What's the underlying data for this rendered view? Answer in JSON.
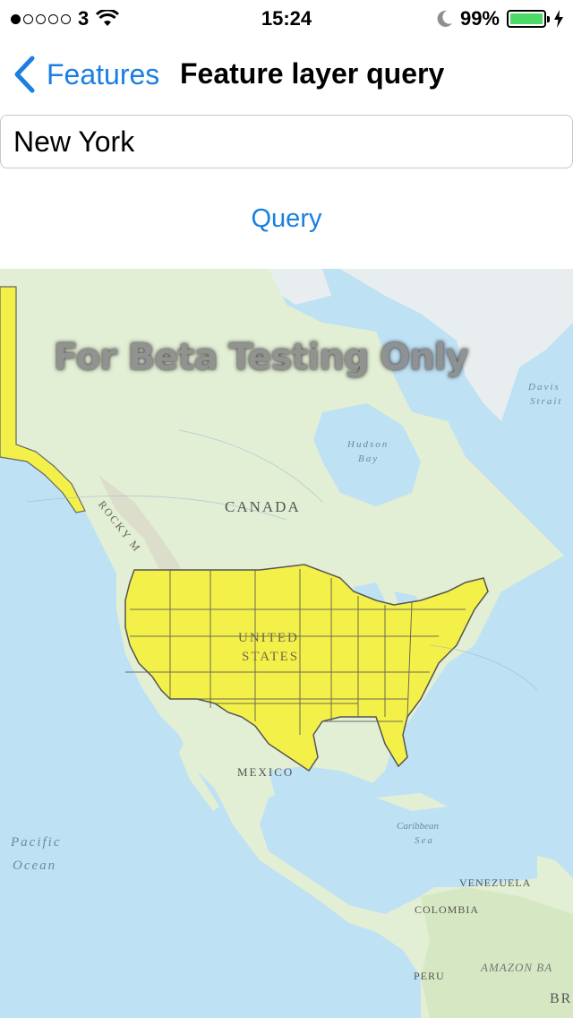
{
  "status_bar": {
    "carrier": "3",
    "time": "15:24",
    "battery": "99%",
    "battery_level": 0.99,
    "signal_bars_filled": 1,
    "signal_bars_total": 5
  },
  "nav": {
    "back_label": "Features",
    "title": "Feature layer query"
  },
  "search": {
    "value": "New York"
  },
  "query_button": {
    "label": "Query"
  },
  "map": {
    "watermark": "For Beta Testing Only",
    "labels": {
      "canada": "CANADA",
      "united": "UNITED",
      "states": "STATES",
      "mexico": "MEXICO",
      "hudson": "Hudson",
      "bay": "Bay",
      "davis": "Davis",
      "strait": "Strait",
      "rocky": "ROCKY M",
      "pacific": "Pacific",
      "ocean": "Ocean",
      "caribbean": "Caribbean",
      "sea": "Sea",
      "venezuela": "VENEZUELA",
      "colombia": "COLOMBIA",
      "peru": "PERU",
      "amazon": "AMAZON BA",
      "brazil": "BR"
    },
    "highlight_color": "#f4f04a",
    "water_color": "#bfe1f4",
    "land_color": "#e3efd4"
  }
}
